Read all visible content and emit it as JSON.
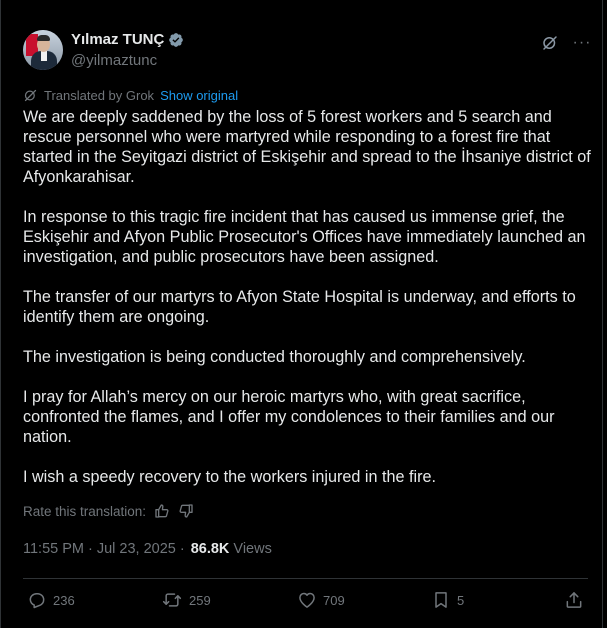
{
  "author": {
    "name": "Yılmaz TUNÇ",
    "handle": "@yilmaztunc",
    "verified": true
  },
  "header_icons": [
    "grok-icon",
    "more-icon"
  ],
  "header_more_label": "···",
  "translation": {
    "label": "Translated by Grok",
    "show_original": "Show original"
  },
  "tweet": {
    "paragraphs": [
      "We are deeply saddened by the loss of 5 forest workers and 5 search and rescue personnel who were martyred while responding to a forest fire that started in the Seyitgazi district of Eskişehir and spread to the İhsaniye district of Afyonkarahisar.",
      "In response to this tragic fire incident that has caused us immense grief, the Eskişehir and Afyon Public Prosecutor's Offices have immediately launched an investigation, and public prosecutors have been assigned.",
      "The transfer of our martyrs to Afyon State Hospital is underway, and efforts to identify them are ongoing.",
      "The investigation is being conducted thoroughly and comprehensively.",
      "I pray for Allah’s mercy on our heroic martyrs who, with great sacrifice, confronted the flames, and I offer my condolences to their families and our nation.",
      "I wish a speedy recovery to the workers injured in the fire."
    ]
  },
  "rate_translation": {
    "label": "Rate this translation:",
    "icons": [
      "thumbs-up-icon",
      "thumbs-down-icon"
    ]
  },
  "meta": {
    "time": "11:55 PM",
    "separator": "·",
    "date": "Jul 23, 2025",
    "views_count": "86.8K",
    "views_label": "Views"
  },
  "actions": {
    "replies": "236",
    "reposts": "259",
    "likes": "709",
    "bookmarks": "5"
  },
  "colors": {
    "background": "#000000",
    "text": "#e7e9ea",
    "muted": "#71767b",
    "link": "#1d9bf0",
    "verified": "#829aab",
    "divider": "#2f3336"
  }
}
